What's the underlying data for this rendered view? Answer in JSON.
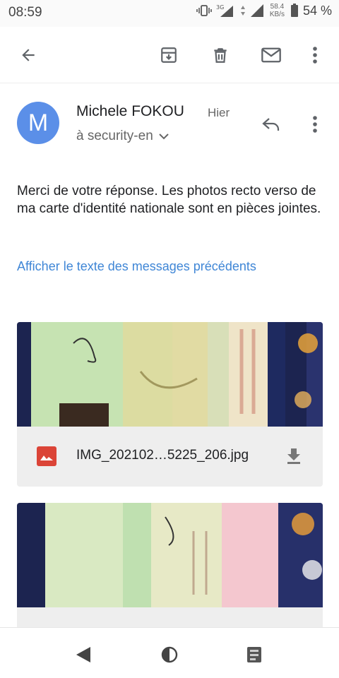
{
  "status_bar": {
    "time": "08:59",
    "network": "3G",
    "speed_value": "58.4",
    "speed_unit": "KB/s",
    "battery": "54 %"
  },
  "toolbar": {
    "icons": [
      "back-arrow-icon",
      "archive-icon",
      "delete-icon",
      "mark-unread-icon",
      "more-vert-icon"
    ]
  },
  "message": {
    "avatar_letter": "M",
    "avatar_color": "#5b8fe8",
    "sender": "Michele FOKOU",
    "date": "Hier",
    "recipient": "à security-en",
    "body": "Merci de votre réponse. Les photos recto verso de ma carte d'identité nationale sont en pièces jointes.",
    "show_quoted": "Afficher le texte des messages précédents",
    "link_color": "#3f86d6"
  },
  "attachments": [
    {
      "filename": "IMG_202102…5225_206.jpg",
      "icon": "image-file-icon"
    },
    {
      "filename": "",
      "icon": "image-file-icon"
    }
  ],
  "nav": {
    "icons": [
      "nav-back-icon",
      "nav-home-icon",
      "nav-recents-icon"
    ]
  }
}
